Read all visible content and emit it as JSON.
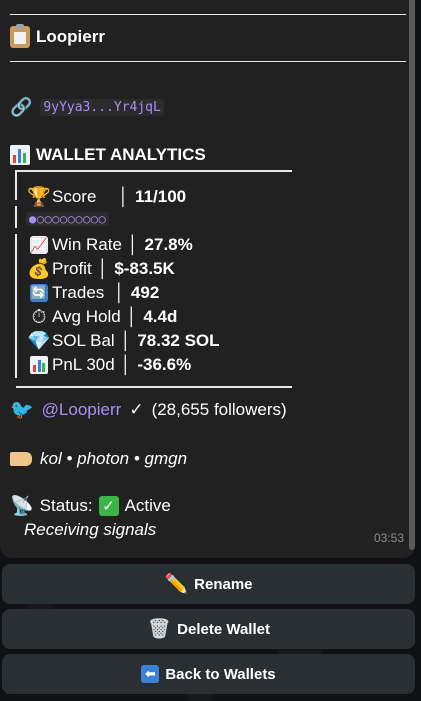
{
  "message": {
    "wallet_name": "Loopierr",
    "address": "9yYya3...Yr4jqL",
    "section_title": "WALLET ANALYTICS",
    "score": {
      "label": "Score",
      "value": "11/100",
      "bar": "●○○○○○○○○○",
      "progress": 0.11
    },
    "rows": [
      {
        "label": "Win Rate",
        "value": "27.8%"
      },
      {
        "label": "Profit",
        "value": "$-83.5K"
      },
      {
        "label": "Trades",
        "value": "492"
      },
      {
        "label": "Avg Hold",
        "value": "4.4d"
      },
      {
        "label": "SOL Bal",
        "value": "78.32 SOL"
      },
      {
        "label": "PnL 30d",
        "value": "-36.6%"
      }
    ],
    "twitter": {
      "handle": "@Loopierr",
      "check": "✓",
      "followers": "(28,655 followers)"
    },
    "tags": "kol • photon • gmgn",
    "status": {
      "prefix": "Status:",
      "value": "Active",
      "sub": "Receiving signals"
    },
    "time": "03:53"
  },
  "keyboard": {
    "rename": "Rename",
    "delete": "Delete Wallet",
    "back": "Back to Wallets"
  },
  "colors": {
    "accent": "#a98df7",
    "bubble": "#212121",
    "button": "#2a2f34",
    "active_check": "#3bb54a"
  }
}
